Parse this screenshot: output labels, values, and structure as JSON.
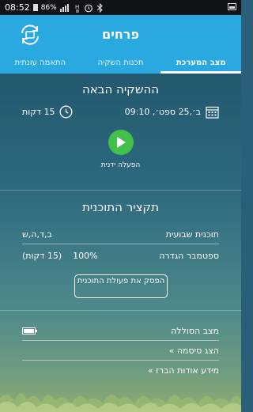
{
  "status_bar": {
    "time": "08:52",
    "battery_percent": "86%"
  },
  "header": {
    "title": "פרחים"
  },
  "tabs": [
    {
      "label": "מצב המערכת",
      "active": true
    },
    {
      "label": "תכנות השקיה",
      "active": false
    },
    {
      "label": "התאמה עונתית",
      "active": false
    }
  ],
  "next_irrigation": {
    "title": "ההשקיה הבאה",
    "datetime": "ב׳,25 ספט׳, 09:10",
    "duration": "15 דקות",
    "manual_label": "הפעלה ידנית"
  },
  "program_summary": {
    "title": "תקציר התוכנית",
    "weekly_label": "תוכנית שבועית",
    "weekly_days": "ב,ד,ה,ש",
    "month_label": "ספטמבר הגדרה",
    "percent": "100%",
    "minutes": "(15 דקות)",
    "stop_button": "הפסק את פעולת התוכנית"
  },
  "links": {
    "battery_status": "מצב הסוללה",
    "battery_level": 1.0,
    "show_password": "הצג סיסמה »",
    "about_faucet": "מידע אודות הברז »"
  },
  "colors": {
    "header": "#2aa8e0",
    "play": "#41c04a"
  }
}
